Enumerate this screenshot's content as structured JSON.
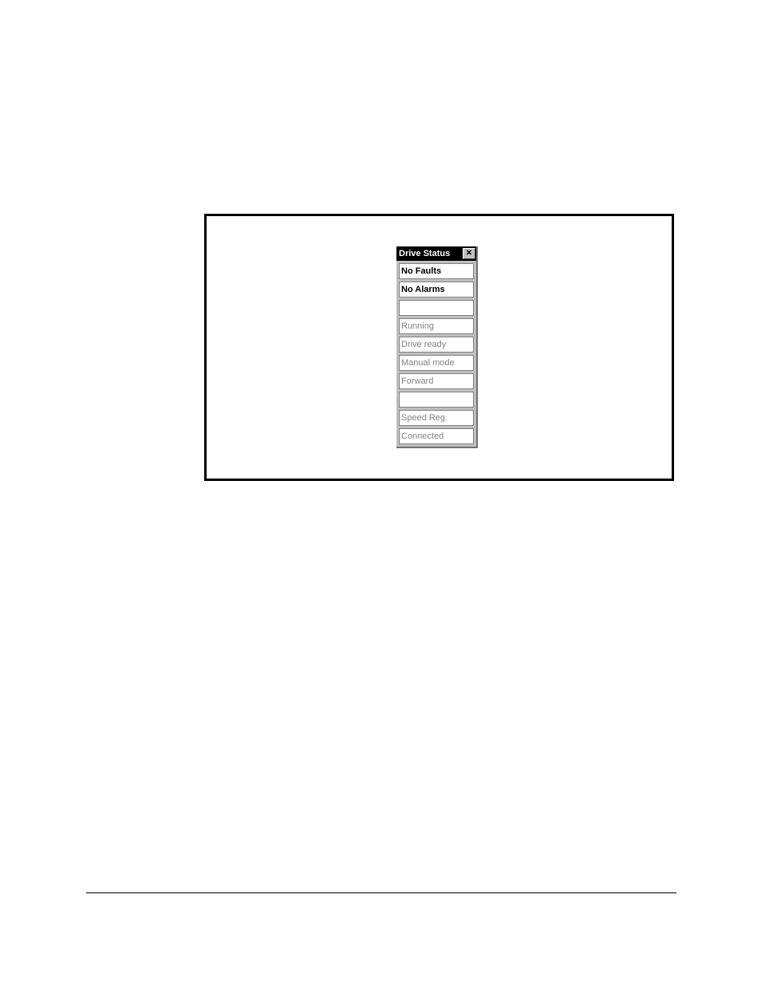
{
  "panel": {
    "title": "Drive Status",
    "fields": {
      "faults": "No Faults",
      "alarms": "No Alarms",
      "blank1": "",
      "running": "Running",
      "drive_ready": "Drive ready",
      "manual_mode": "Manual mode",
      "forward": "Forward",
      "blank2": "",
      "speed_reg": "Speed Reg.",
      "connected": "Connected"
    }
  }
}
